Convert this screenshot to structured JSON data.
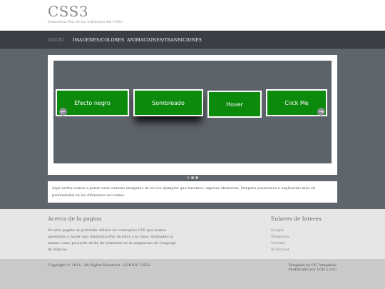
{
  "header": {
    "title": "CSS3",
    "subtitle": "Demostraci¾n de las utilidades del CSS3"
  },
  "nav": {
    "items": [
      {
        "label": "INICIO"
      },
      {
        "label": "IMAGENES/COLORES"
      },
      {
        "label": "ANIMACIONES/TRANSICIONES"
      }
    ]
  },
  "slider": {
    "boxes": [
      {
        "label": "Efecto negro"
      },
      {
        "label": "Sombreado"
      },
      {
        "label": "Hover"
      },
      {
        "label": "Click Me"
      }
    ],
    "prev_icon": "arrow-left-icon",
    "next_icon": "arrow-right-icon",
    "dots": 3,
    "active_dot": 1
  },
  "description": "Aqui arriba vamos a poner unas cuantas imagenes de los los ejemplos que haremos, algunas aleatorias. Despues pasaremos a explicarlas mÁs en profundidad en las diferentes secciones.",
  "about": {
    "heading": "Acerca de la pagina",
    "text": "En esta pagina se pretende utilizar los conceptos CSS que hemos aprendido y hacer una demostraci¾n de ellos a la clase, utilizando la misma como proyecto de fin de trimestre en la asignatura de Lenguaje de Marcas."
  },
  "links": {
    "heading": "Enlaces de Interes",
    "items": [
      {
        "label": "Google"
      },
      {
        "label": "Wikipedia"
      },
      {
        "label": "Youtube"
      },
      {
        "label": "W3School"
      }
    ]
  },
  "footer": {
    "copyright": "Copyright © 2014 - All Rights Reserved - LGNIGG CSS3",
    "credit_line1": "Template by OS Templates",
    "credit_line2": "Modificado por LGN y IGG"
  },
  "colors": {
    "nav_bg": "#3a3f45",
    "banner_bg": "#5f656c",
    "box_green": "#0b8a0b",
    "info_bg": "#e6e6e6",
    "footer_bg": "#c9c9c9"
  }
}
